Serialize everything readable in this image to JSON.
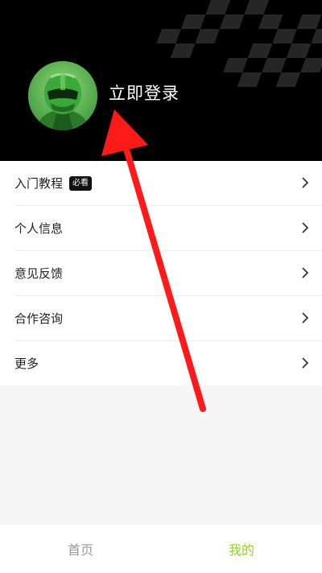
{
  "profile": {
    "login_label": "立即登录",
    "avatar_icon": "racing-driver-avatar"
  },
  "menu": {
    "items": [
      {
        "label": "入门教程",
        "badge": "必看"
      },
      {
        "label": "个人信息"
      },
      {
        "label": "意见反馈"
      },
      {
        "label": "合作咨询"
      },
      {
        "label": "更多"
      }
    ]
  },
  "tabbar": {
    "tabs": [
      {
        "label": "首页",
        "active": false
      },
      {
        "label": "我的",
        "active": true
      }
    ],
    "active_color": "#8cd32a",
    "inactive_color": "#999999"
  },
  "colors": {
    "header_bg": "#000000",
    "annotation_arrow": "#ff1a1a"
  }
}
